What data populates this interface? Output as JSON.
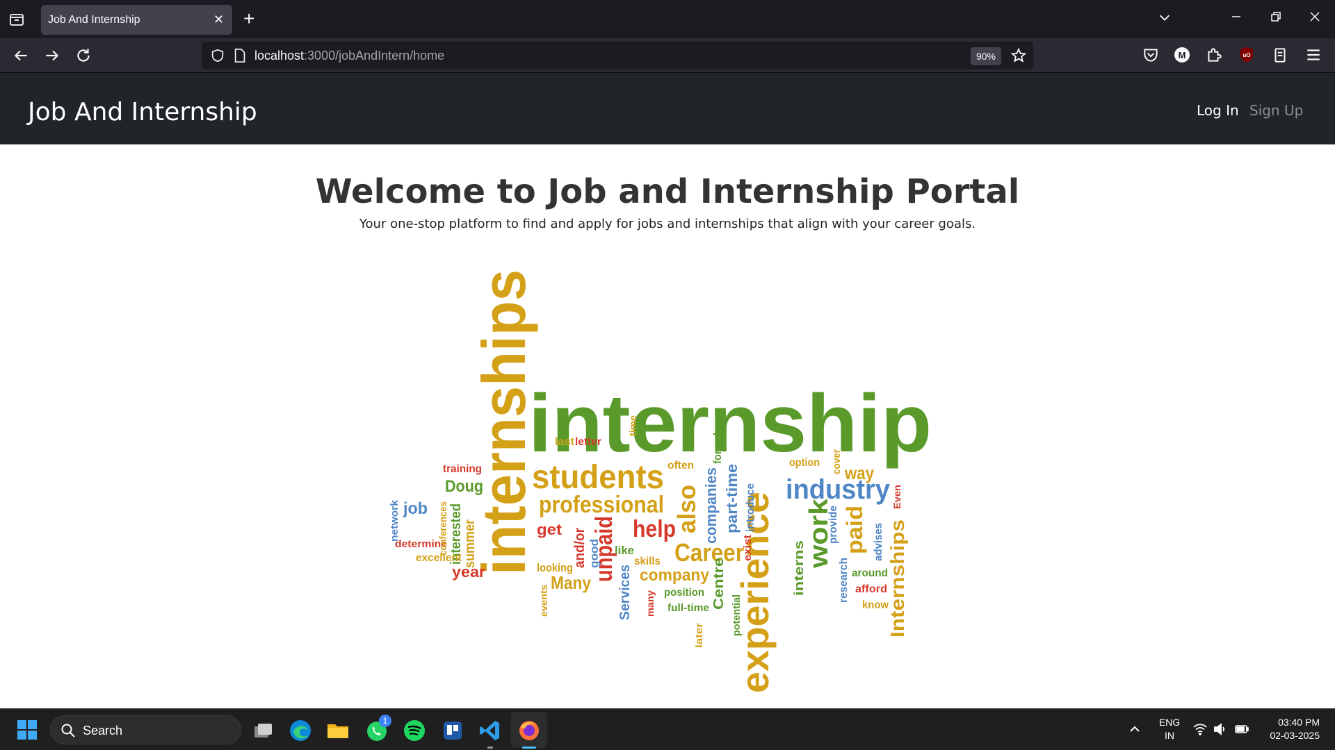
{
  "browser": {
    "tab_title": "Job And Internship",
    "tab_close": "✕",
    "new_tab": "+",
    "url_host": "localhost",
    "url_path": ":3000/jobAndIntern/home",
    "zoom": "90%"
  },
  "header": {
    "brand": "Job And Internship",
    "login": "Log In",
    "signup": "Sign Up"
  },
  "hero": {
    "title": "Welcome to Job and Internship Portal",
    "subtitle": "Your one-stop platform to find and apply for jobs and internships that align with your career goals."
  },
  "wordcloud": {
    "colors": {
      "green": "#5a9a2b",
      "gold": "#d4a017",
      "red": "#d6392b",
      "blue": "#4f86c6"
    },
    "words": [
      {
        "text": "internship",
        "color": "green"
      },
      {
        "text": "internships",
        "color": "gold"
      },
      {
        "text": "experience",
        "color": "gold"
      },
      {
        "text": "students",
        "color": "gold"
      },
      {
        "text": "professional",
        "color": "gold"
      },
      {
        "text": "industry",
        "color": "blue"
      },
      {
        "text": "Career",
        "color": "gold"
      },
      {
        "text": "help",
        "color": "red"
      },
      {
        "text": "work",
        "color": "green"
      },
      {
        "text": "unpaid",
        "color": "red"
      },
      {
        "text": "also",
        "color": "gold"
      },
      {
        "text": "companies",
        "color": "blue"
      },
      {
        "text": "part-time",
        "color": "blue"
      },
      {
        "text": "company",
        "color": "gold"
      },
      {
        "text": "Many",
        "color": "gold"
      },
      {
        "text": "year",
        "color": "red"
      },
      {
        "text": "summer",
        "color": "gold"
      },
      {
        "text": "interested",
        "color": "green"
      },
      {
        "text": "Doug",
        "color": "green"
      },
      {
        "text": "job",
        "color": "blue"
      },
      {
        "text": "training",
        "color": "red"
      },
      {
        "text": "last",
        "color": "gold"
      },
      {
        "text": "letter",
        "color": "red"
      },
      {
        "text": "paid",
        "color": "gold"
      },
      {
        "text": "way",
        "color": "gold"
      },
      {
        "text": "Internships",
        "color": "gold"
      },
      {
        "text": "interns",
        "color": "green"
      },
      {
        "text": "research",
        "color": "blue"
      },
      {
        "text": "provide",
        "color": "blue"
      },
      {
        "text": "around",
        "color": "green"
      },
      {
        "text": "afford",
        "color": "red"
      },
      {
        "text": "know",
        "color": "gold"
      },
      {
        "text": "advises",
        "color": "blue"
      },
      {
        "text": "Services",
        "color": "blue"
      },
      {
        "text": "Centre",
        "color": "green"
      },
      {
        "text": "position",
        "color": "green"
      },
      {
        "text": "full-time",
        "color": "green"
      },
      {
        "text": "formal",
        "color": "green"
      },
      {
        "text": "introduce",
        "color": "blue"
      },
      {
        "text": "exist",
        "color": "red"
      },
      {
        "text": "option",
        "color": "gold"
      },
      {
        "text": "cover",
        "color": "gold"
      },
      {
        "text": "often",
        "color": "gold"
      },
      {
        "text": "get",
        "color": "red"
      },
      {
        "text": "and/or",
        "color": "red"
      },
      {
        "text": "looking",
        "color": "gold"
      },
      {
        "text": "good",
        "color": "blue"
      },
      {
        "text": "skills",
        "color": "gold"
      },
      {
        "text": "like",
        "color": "green"
      },
      {
        "text": "excellent",
        "color": "gold"
      },
      {
        "text": "determine",
        "color": "red"
      },
      {
        "text": "network",
        "color": "blue"
      },
      {
        "text": "conferences",
        "color": "gold"
      },
      {
        "text": "potential",
        "color": "green"
      },
      {
        "text": "events",
        "color": "gold"
      },
      {
        "text": "many",
        "color": "red"
      },
      {
        "text": "later",
        "color": "gold"
      },
      {
        "text": "time",
        "color": "gold"
      },
      {
        "text": "Even",
        "color": "red"
      }
    ]
  },
  "taskbar": {
    "search_label": "Search",
    "whatsapp_badge": "1",
    "lang_top": "ENG",
    "lang_bottom": "IN",
    "time": "03:40 PM",
    "date": "02-03-2025"
  }
}
